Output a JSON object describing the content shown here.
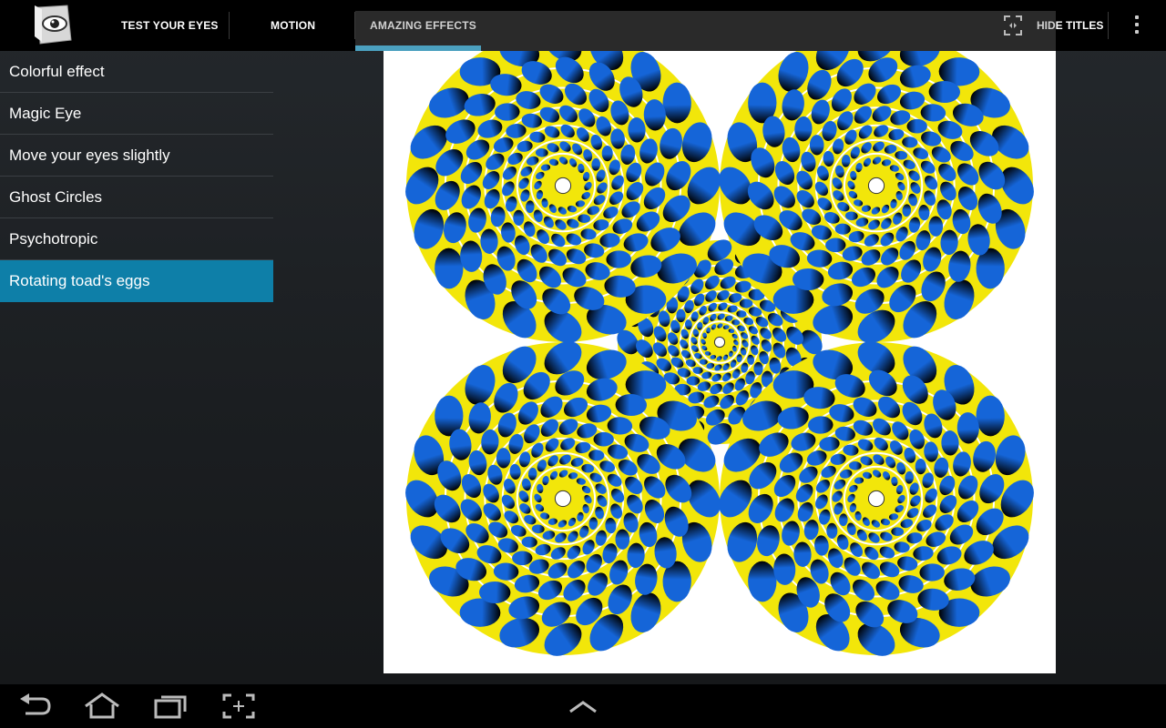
{
  "tabs": [
    {
      "label": "TEST YOUR EYES",
      "selected": false
    },
    {
      "label": "MOTION",
      "selected": false
    },
    {
      "label": "AMAZING EFFECTS",
      "selected": true
    }
  ],
  "actions": {
    "hide_titles_label": "HIDE TITLES"
  },
  "list": {
    "items": [
      {
        "label": "Colorful effect",
        "selected": false
      },
      {
        "label": "Magic Eye",
        "selected": false
      },
      {
        "label": "Move your eyes slightly",
        "selected": false
      },
      {
        "label": "Ghost Circles",
        "selected": false
      },
      {
        "label": "Psychotropic",
        "selected": false
      },
      {
        "label": "Rotating toad's eggs",
        "selected": true
      }
    ]
  },
  "icons": {
    "app": "eye-logo-icon",
    "hide_titles": "fullscreen-icon",
    "overflow": "overflow-menu-icon",
    "back": "back-icon",
    "home": "home-icon",
    "recents": "recent-apps-icon",
    "screenshot": "screenshot-icon",
    "up": "chevron-up-icon"
  },
  "colors": {
    "accent": "#33b5e5",
    "selected_row": "#0e7fa8",
    "illusion_yellow": "#f2e60a",
    "illusion_blue": "#1565d8"
  }
}
